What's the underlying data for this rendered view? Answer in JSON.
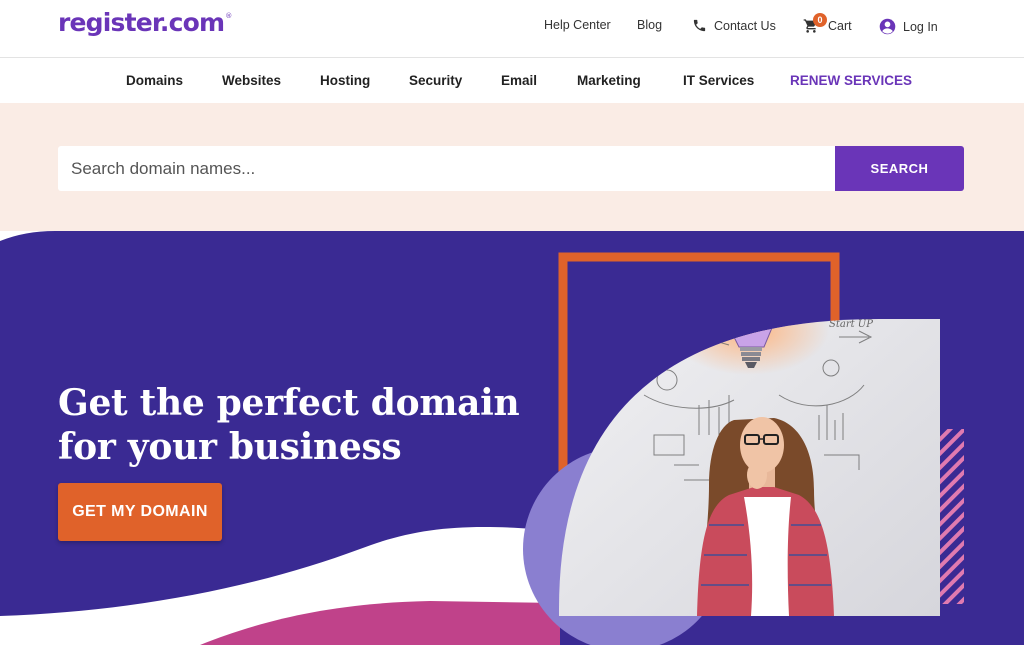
{
  "logo": {
    "text": "register.com",
    "mark": "®"
  },
  "header": {
    "links": [
      {
        "label": "Help Center"
      },
      {
        "label": "Blog"
      },
      {
        "label": "Contact Us",
        "icon": "phone-icon"
      },
      {
        "label": "Cart",
        "icon": "cart-icon",
        "badge": "0"
      },
      {
        "label": "Log In",
        "icon": "user-icon"
      }
    ]
  },
  "nav": {
    "items": [
      {
        "label": "Domains"
      },
      {
        "label": "Websites"
      },
      {
        "label": "Hosting"
      },
      {
        "label": "Security"
      },
      {
        "label": "Email"
      },
      {
        "label": "Marketing"
      },
      {
        "label": "IT Services"
      },
      {
        "label": "RENEW SERVICES"
      }
    ]
  },
  "search": {
    "placeholder": "Search domain names...",
    "value": "",
    "button_label": "SEARCH"
  },
  "hero": {
    "title_line1": "Get the perfect domain",
    "title_line2": "for your business",
    "cta_label": "GET MY DOMAIN",
    "photo_sketch_text": "Start UP"
  },
  "colors": {
    "brand_purple": "#6a35b8",
    "hero_bg": "#3a2a93",
    "accent_orange": "#e0622a",
    "search_band": "#faece5",
    "lavender": "#8a7fd0",
    "pink": "#c0428a"
  }
}
